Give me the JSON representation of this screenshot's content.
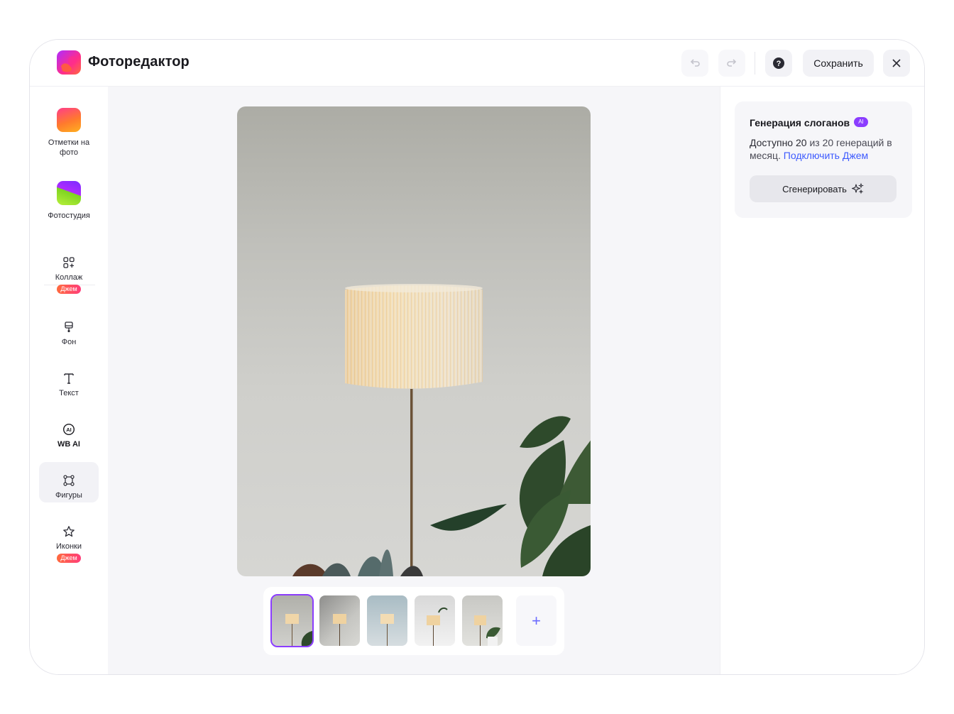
{
  "app": {
    "title": "Фоторедактор"
  },
  "header": {
    "undo_icon": "undo-icon",
    "redo_icon": "redo-icon",
    "help_icon": "help-icon",
    "save_label": "Сохранить",
    "close_icon": "close-icon"
  },
  "sidebar": {
    "items": [
      {
        "label": "Отметки на фото",
        "icon": "photo-tags-icon"
      },
      {
        "label": "Фотостудия",
        "icon": "photostudio-icon"
      },
      {
        "label": "Коллаж",
        "icon": "collage-icon",
        "badge": "Джем"
      },
      {
        "label": "Фон",
        "icon": "brush-icon"
      },
      {
        "label": "Текст",
        "icon": "text-icon"
      },
      {
        "label": "WB AI",
        "icon": "ai-icon",
        "active": true
      },
      {
        "label": "Фигуры",
        "icon": "shapes-icon"
      },
      {
        "label": "Иконки",
        "icon": "star-icon",
        "badge": "Джем"
      }
    ]
  },
  "canvas": {
    "thumbnails_count": 5,
    "selected_index": 0,
    "add_label": "+"
  },
  "panel": {
    "title": "Генерация слоганов",
    "ai_badge": "AI",
    "quota_prefix": "Доступно",
    "quota_value": "20",
    "quota_rest": "из 20 генераций в месяц.",
    "link": "Подключить Джем",
    "generate_label": "Сгенерировать"
  },
  "colors": {
    "accent": "#8b3dff",
    "link": "#3d5afe",
    "badge": "#ff5a4f"
  }
}
